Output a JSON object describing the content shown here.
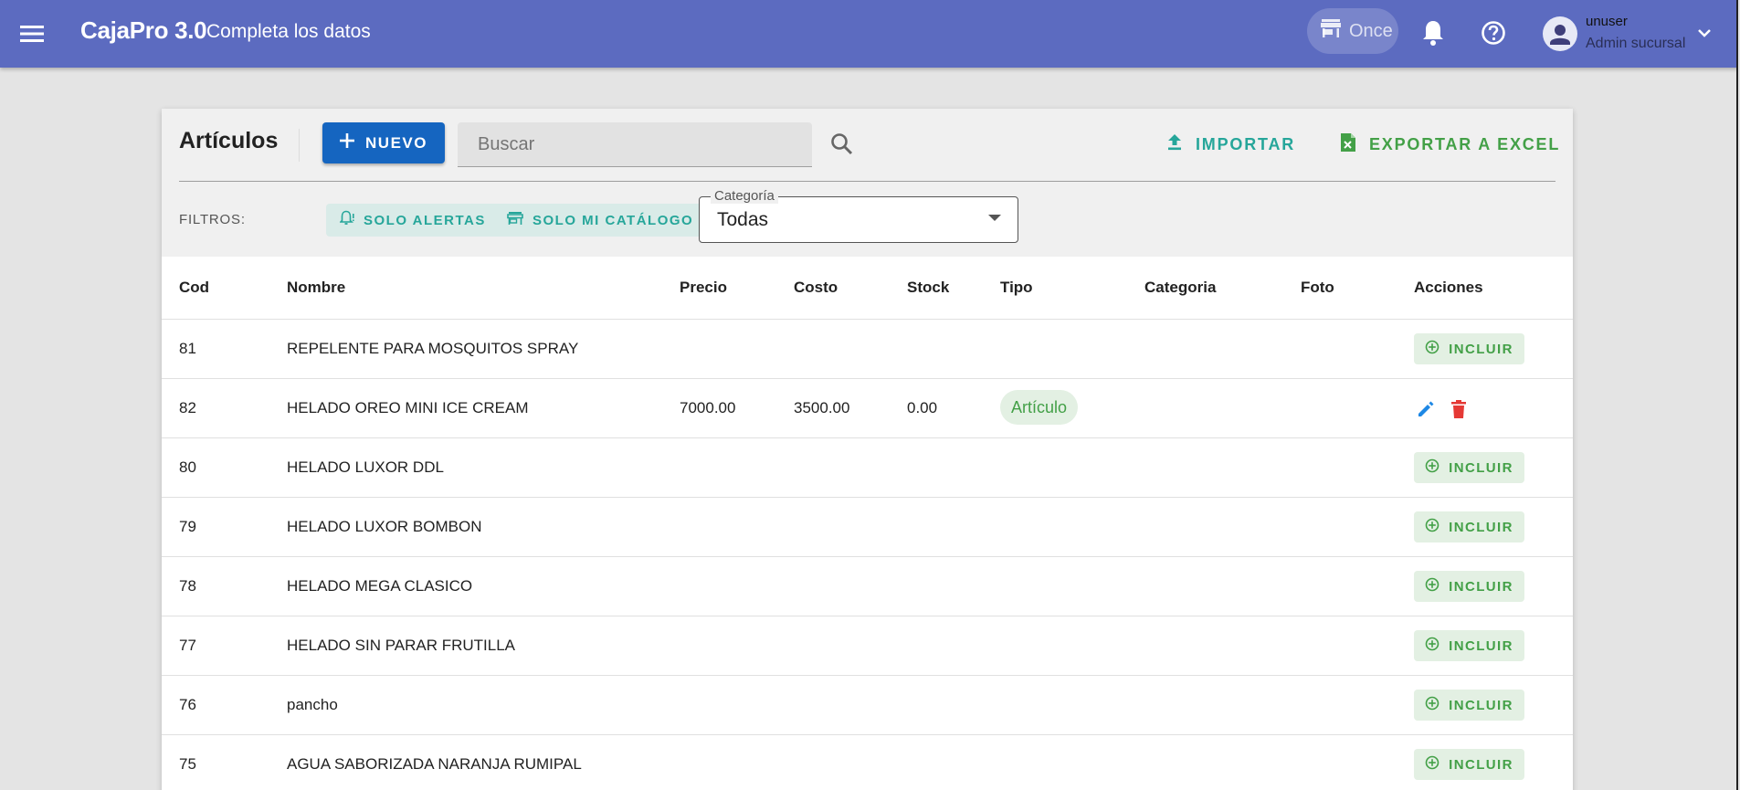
{
  "appbar": {
    "title": "CajaPro 3.0",
    "subtitle": "Completa los datos",
    "branch": "Once",
    "user_name": "unuser",
    "user_role": "Admin sucursal"
  },
  "toolbar": {
    "title": "Artículos",
    "new_label": "NUEVO",
    "search_placeholder": "Buscar",
    "import_label": "IMPORTAR",
    "export_label": "EXPORTAR A EXCEL"
  },
  "filters": {
    "label": "FILTROS:",
    "only_alerts": "SOLO ALERTAS",
    "only_catalog": "SOLO MI CATÁLOGO",
    "category_label": "Categoría",
    "category_value": "Todas"
  },
  "table": {
    "columns": [
      "Cod",
      "Nombre",
      "Precio",
      "Costo",
      "Stock",
      "Tipo",
      "Categoria",
      "Foto",
      "Acciones"
    ],
    "include_label": "INCLUIR",
    "rows": [
      {
        "cod": "81",
        "nombre": "REPELENTE PARA MOSQUITOS SPRAY",
        "precio": "",
        "costo": "",
        "stock": "",
        "tipo": "",
        "included": false
      },
      {
        "cod": "82",
        "nombre": "HELADO OREO MINI ICE CREAM",
        "precio": "7000.00",
        "costo": "3500.00",
        "stock": "0.00",
        "tipo": "Artículo",
        "included": true
      },
      {
        "cod": "80",
        "nombre": "HELADO LUXOR DDL",
        "precio": "",
        "costo": "",
        "stock": "",
        "tipo": "",
        "included": false
      },
      {
        "cod": "79",
        "nombre": "HELADO LUXOR BOMBON",
        "precio": "",
        "costo": "",
        "stock": "",
        "tipo": "",
        "included": false
      },
      {
        "cod": "78",
        "nombre": "HELADO MEGA CLASICO",
        "precio": "",
        "costo": "",
        "stock": "",
        "tipo": "",
        "included": false
      },
      {
        "cod": "77",
        "nombre": "HELADO SIN PARAR FRUTILLA",
        "precio": "",
        "costo": "",
        "stock": "",
        "tipo": "",
        "included": false
      },
      {
        "cod": "76",
        "nombre": "pancho",
        "precio": "",
        "costo": "",
        "stock": "",
        "tipo": "",
        "included": false
      },
      {
        "cod": "75",
        "nombre": "AGUA SABORIZADA NARANJA RUMIPAL",
        "precio": "",
        "costo": "",
        "stock": "",
        "tipo": "",
        "included": false
      }
    ]
  },
  "colors": {
    "appbar": "#5c6bc0",
    "primary_button": "#1565c0",
    "teal": "#26a69a",
    "green": "#43a047",
    "edit_icon": "#1e88e5",
    "delete_icon": "#e53935"
  }
}
